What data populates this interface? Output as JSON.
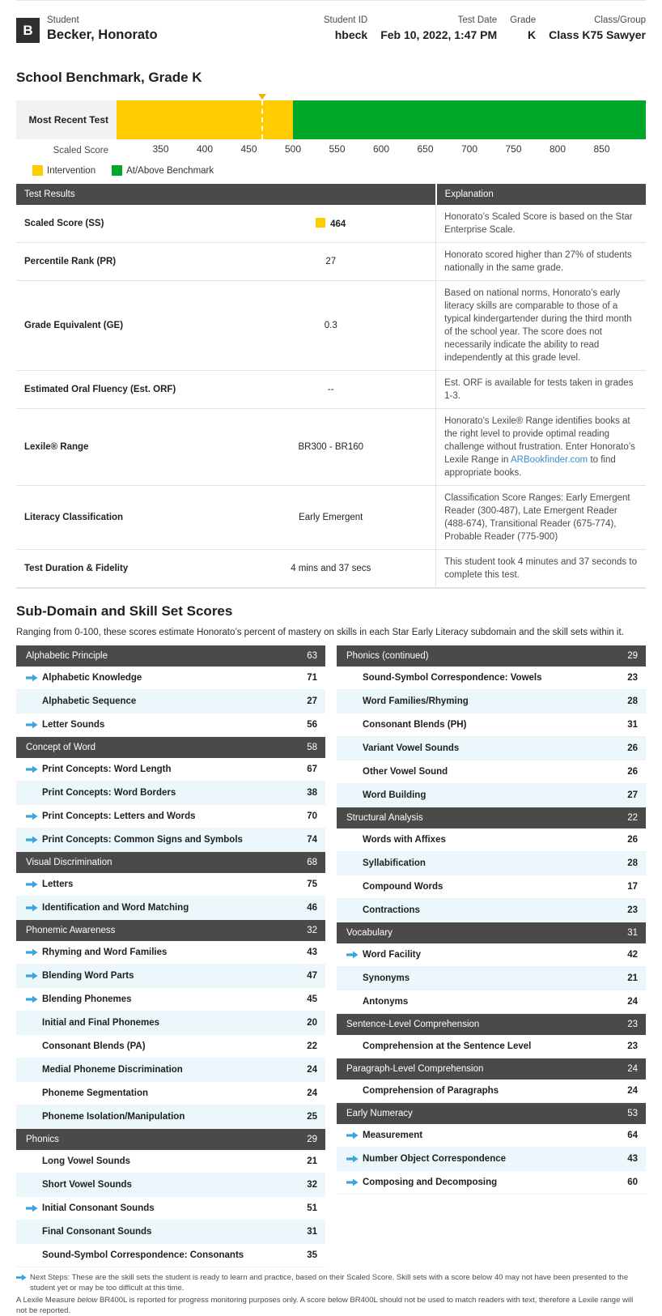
{
  "header": {
    "student_label": "Student",
    "student_name": "Becker, Honorato",
    "avatar_initial": "B",
    "fields": [
      {
        "label": "Student ID",
        "value": "hbeck"
      },
      {
        "label": "Test Date",
        "value": "Feb 10, 2022, 1:47 PM"
      },
      {
        "label": "Grade",
        "value": "K"
      },
      {
        "label": "Class/Group",
        "value": "Class K75 Sawyer"
      }
    ]
  },
  "benchmark": {
    "title": "School Benchmark, Grade K",
    "row_label": "Most Recent Test",
    "axis_label": "Scaled Score",
    "legend": [
      {
        "label": "Intervention",
        "color": "#ffcc00"
      },
      {
        "label": "At/Above Benchmark",
        "color": "#00a829"
      }
    ]
  },
  "chart_data": {
    "type": "bar",
    "title": "School Benchmark, Grade K",
    "xlabel": "Scaled Score",
    "ylabel": "",
    "xlim": [
      300,
      900
    ],
    "ticks": [
      350,
      400,
      450,
      500,
      550,
      600,
      650,
      700,
      750,
      800,
      850
    ],
    "grid": false,
    "legend_position": "bottom-left",
    "bands": [
      {
        "name": "Intervention",
        "from": 300,
        "to": 500,
        "color": "#ffcc00"
      },
      {
        "name": "At/Above Benchmark",
        "from": 500,
        "to": 900,
        "color": "#00a829"
      }
    ],
    "series": [
      {
        "name": "Most Recent Test",
        "value": 464,
        "marker": "triangle",
        "marker_color": "#f0b400"
      }
    ]
  },
  "results": {
    "col_headers": [
      "Test Results",
      "Explanation"
    ],
    "rows": [
      {
        "name": "Scaled Score (SS)",
        "value": "464",
        "chip": "#ffcc00",
        "bold": true,
        "explanation": "Honorato’s Scaled Score is based on the Star Enterprise Scale."
      },
      {
        "name": "Percentile Rank (PR)",
        "value": "27",
        "explanation": "Honorato scored higher than 27% of students nationally in the same grade."
      },
      {
        "name": "Grade Equivalent (GE)",
        "value": "0.3",
        "explanation": "Based on national norms, Honorato’s early literacy skills are comparable to those of a typical kindergartender during the third month of the school year. The score does not necessarily indicate the ability to read independently at this grade level."
      },
      {
        "name": "Estimated Oral Fluency (Est. ORF)",
        "value": "--",
        "explanation": "Est. ORF is available for tests taken in grades 1-3."
      },
      {
        "name": "Lexile® Range",
        "value": "BR300 - BR160",
        "explanation_pre": "Honorato’s Lexile® Range identifies books at the right level to provide optimal reading challenge without frustration. Enter Honorato’s Lexile Range in ",
        "explanation_link": "ARBookfinder.com",
        "explanation_post": " to find appropriate books."
      },
      {
        "name": "Literacy Classification",
        "value": "Early Emergent",
        "explanation": "Classification Score Ranges: Early Emergent Reader (300-487), Late Emergent Reader (488-674), Transitional Reader (675-774), Probable Reader (775-900)"
      },
      {
        "name": "Test Duration & Fidelity",
        "value": "4 mins and 37 secs",
        "explanation": "This student took 4 minutes and 37 seconds to complete this test."
      }
    ]
  },
  "subdomain": {
    "title": "Sub-Domain and Skill Set Scores",
    "intro": "Ranging from 0-100, these scores estimate Honorato’s percent of mastery on skills in each Star Early Literacy subdomain and the skill sets within it.",
    "left_column": [
      {
        "type": "group",
        "name": "Alphabetic Principle",
        "score": "63"
      },
      {
        "type": "skill",
        "name": "Alphabetic Knowledge",
        "score": "71",
        "arrow": true,
        "alt": false
      },
      {
        "type": "skill",
        "name": "Alphabetic Sequence",
        "score": "27",
        "arrow": false,
        "alt": true
      },
      {
        "type": "skill",
        "name": "Letter Sounds",
        "score": "56",
        "arrow": true,
        "alt": false
      },
      {
        "type": "group",
        "name": "Concept of Word",
        "score": "58"
      },
      {
        "type": "skill",
        "name": "Print Concepts: Word Length",
        "score": "67",
        "arrow": true,
        "alt": false
      },
      {
        "type": "skill",
        "name": "Print Concepts: Word Borders",
        "score": "38",
        "arrow": false,
        "alt": true
      },
      {
        "type": "skill",
        "name": "Print Concepts: Letters and Words",
        "score": "70",
        "arrow": true,
        "alt": false
      },
      {
        "type": "skill",
        "name": "Print Concepts: Common Signs and Symbols",
        "score": "74",
        "arrow": true,
        "alt": true
      },
      {
        "type": "group",
        "name": "Visual Discrimination",
        "score": "68"
      },
      {
        "type": "skill",
        "name": "Letters",
        "score": "75",
        "arrow": true,
        "alt": false
      },
      {
        "type": "skill",
        "name": "Identification and Word Matching",
        "score": "46",
        "arrow": true,
        "alt": true
      },
      {
        "type": "group",
        "name": "Phonemic Awareness",
        "score": "32"
      },
      {
        "type": "skill",
        "name": "Rhyming and Word Families",
        "score": "43",
        "arrow": true,
        "alt": false
      },
      {
        "type": "skill",
        "name": "Blending Word Parts",
        "score": "47",
        "arrow": true,
        "alt": true
      },
      {
        "type": "skill",
        "name": "Blending Phonemes",
        "score": "45",
        "arrow": true,
        "alt": false
      },
      {
        "type": "skill",
        "name": "Initial and Final Phonemes",
        "score": "20",
        "arrow": false,
        "alt": true
      },
      {
        "type": "skill",
        "name": "Consonant Blends (PA)",
        "score": "22",
        "arrow": false,
        "alt": false
      },
      {
        "type": "skill",
        "name": "Medial Phoneme Discrimination",
        "score": "24",
        "arrow": false,
        "alt": true
      },
      {
        "type": "skill",
        "name": "Phoneme Segmentation",
        "score": "24",
        "arrow": false,
        "alt": false
      },
      {
        "type": "skill",
        "name": "Phoneme Isolation/Manipulation",
        "score": "25",
        "arrow": false,
        "alt": true
      },
      {
        "type": "group",
        "name": "Phonics",
        "score": "29"
      },
      {
        "type": "skill",
        "name": "Long Vowel Sounds",
        "score": "21",
        "arrow": false,
        "alt": false
      },
      {
        "type": "skill",
        "name": "Short Vowel Sounds",
        "score": "32",
        "arrow": false,
        "alt": true
      },
      {
        "type": "skill",
        "name": "Initial Consonant Sounds",
        "score": "51",
        "arrow": true,
        "alt": false
      },
      {
        "type": "skill",
        "name": "Final Consonant Sounds",
        "score": "31",
        "arrow": false,
        "alt": true
      },
      {
        "type": "skill",
        "name": "Sound-Symbol Correspondence: Consonants",
        "score": "35",
        "arrow": false,
        "alt": false
      }
    ],
    "right_column": [
      {
        "type": "group",
        "name": "Phonics (continued)",
        "score": "29"
      },
      {
        "type": "skill",
        "name": "Sound-Symbol Correspondence: Vowels",
        "score": "23",
        "arrow": false,
        "alt": false
      },
      {
        "type": "skill",
        "name": "Word Families/Rhyming",
        "score": "28",
        "arrow": false,
        "alt": true
      },
      {
        "type": "skill",
        "name": "Consonant Blends (PH)",
        "score": "31",
        "arrow": false,
        "alt": false
      },
      {
        "type": "skill",
        "name": "Variant Vowel Sounds",
        "score": "26",
        "arrow": false,
        "alt": true
      },
      {
        "type": "skill",
        "name": "Other Vowel Sound",
        "score": "26",
        "arrow": false,
        "alt": false
      },
      {
        "type": "skill",
        "name": "Word Building",
        "score": "27",
        "arrow": false,
        "alt": true
      },
      {
        "type": "group",
        "name": "Structural Analysis",
        "score": "22"
      },
      {
        "type": "skill",
        "name": "Words with Affixes",
        "score": "26",
        "arrow": false,
        "alt": false
      },
      {
        "type": "skill",
        "name": "Syllabification",
        "score": "28",
        "arrow": false,
        "alt": true
      },
      {
        "type": "skill",
        "name": "Compound Words",
        "score": "17",
        "arrow": false,
        "alt": false
      },
      {
        "type": "skill",
        "name": "Contractions",
        "score": "23",
        "arrow": false,
        "alt": true
      },
      {
        "type": "group",
        "name": "Vocabulary",
        "score": "31"
      },
      {
        "type": "skill",
        "name": "Word Facility",
        "score": "42",
        "arrow": true,
        "alt": false
      },
      {
        "type": "skill",
        "name": "Synonyms",
        "score": "21",
        "arrow": false,
        "alt": true
      },
      {
        "type": "skill",
        "name": "Antonyms",
        "score": "24",
        "arrow": false,
        "alt": false
      },
      {
        "type": "group",
        "name": "Sentence-Level Comprehension",
        "score": "23"
      },
      {
        "type": "skill",
        "name": "Comprehension at the Sentence Level",
        "score": "23",
        "arrow": false,
        "alt": false
      },
      {
        "type": "group",
        "name": "Paragraph-Level Comprehension",
        "score": "24"
      },
      {
        "type": "skill",
        "name": "Comprehension of Paragraphs",
        "score": "24",
        "arrow": false,
        "alt": false
      },
      {
        "type": "group",
        "name": "Early Numeracy",
        "score": "53"
      },
      {
        "type": "skill",
        "name": "Measurement",
        "score": "64",
        "arrow": true,
        "alt": false
      },
      {
        "type": "skill",
        "name": "Number Object Correspondence",
        "score": "43",
        "arrow": true,
        "alt": true
      },
      {
        "type": "skill",
        "name": "Composing and Decomposing",
        "score": "60",
        "arrow": true,
        "alt": false
      }
    ]
  },
  "footnotes": {
    "next_steps": "Next Steps: These are the skill sets the student is ready to learn and practice, based on their Scaled Score. Skill sets with a score below 40 may not have been presented to the student yet or may be too difficult at this time.",
    "lexile_pre": "A Lexile Measure ",
    "lexile_em": "below",
    "lexile_post": " BR400L is reported for progress monitoring purposes only. A score below BR400L should not be used to match readers with text, therefore a Lexile range will not be reported."
  }
}
